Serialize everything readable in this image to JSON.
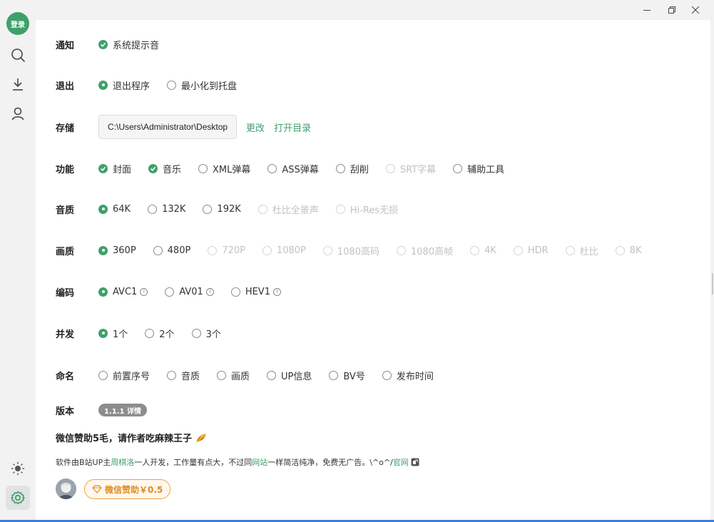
{
  "window": {
    "controls": [
      "minimize-icon",
      "restore-icon",
      "close-icon"
    ]
  },
  "sidebar": {
    "login_label": "登录",
    "icons": [
      "search-icon",
      "download-icon",
      "user-icon",
      "sun-icon",
      "gear-icon"
    ]
  },
  "settings": {
    "notify": {
      "label": "通知",
      "options": [
        {
          "label": "系统提示音",
          "checked": true
        }
      ]
    },
    "exit": {
      "label": "退出",
      "options": [
        {
          "label": "退出程序",
          "checked": true
        },
        {
          "label": "最小化到托盘",
          "checked": false
        }
      ]
    },
    "storage": {
      "label": "存储",
      "path": "C:\\Users\\Administrator\\Desktop",
      "change_label": "更改",
      "open_label": "打开目录"
    },
    "features": {
      "label": "功能",
      "options": [
        {
          "label": "封面",
          "checked": true,
          "disabled": false
        },
        {
          "label": "音乐",
          "checked": true,
          "disabled": false
        },
        {
          "label": "XML弹幕",
          "checked": false,
          "disabled": false
        },
        {
          "label": "ASS弹幕",
          "checked": false,
          "disabled": false
        },
        {
          "label": "刮削",
          "checked": false,
          "disabled": false
        },
        {
          "label": "SRT字幕",
          "checked": false,
          "disabled": true
        },
        {
          "label": "辅助工具",
          "checked": false,
          "disabled": false
        }
      ]
    },
    "audio": {
      "label": "音质",
      "options": [
        {
          "label": "64K",
          "checked": true,
          "disabled": false
        },
        {
          "label": "132K",
          "checked": false,
          "disabled": false
        },
        {
          "label": "192K",
          "checked": false,
          "disabled": false
        },
        {
          "label": "杜比全景声",
          "checked": false,
          "disabled": true
        },
        {
          "label": "Hi-Res无损",
          "checked": false,
          "disabled": true
        }
      ]
    },
    "video": {
      "label": "画质",
      "options": [
        {
          "label": "360P",
          "checked": true,
          "disabled": false
        },
        {
          "label": "480P",
          "checked": false,
          "disabled": false
        },
        {
          "label": "720P",
          "checked": false,
          "disabled": true
        },
        {
          "label": "1080P",
          "checked": false,
          "disabled": true
        },
        {
          "label": "1080高码",
          "checked": false,
          "disabled": true
        },
        {
          "label": "1080高帧",
          "checked": false,
          "disabled": true
        },
        {
          "label": "4K",
          "checked": false,
          "disabled": true
        },
        {
          "label": "HDR",
          "checked": false,
          "disabled": true
        },
        {
          "label": "杜比",
          "checked": false,
          "disabled": true
        },
        {
          "label": "8K",
          "checked": false,
          "disabled": true
        }
      ]
    },
    "codec": {
      "label": "编码",
      "info_glyph": "i",
      "options": [
        {
          "label": "AVC1",
          "checked": true
        },
        {
          "label": "AV01",
          "checked": false
        },
        {
          "label": "HEV1",
          "checked": false
        }
      ]
    },
    "concurrency": {
      "label": "并发",
      "options": [
        {
          "label": "1个",
          "checked": true
        },
        {
          "label": "2个",
          "checked": false
        },
        {
          "label": "3个",
          "checked": false
        }
      ]
    },
    "naming": {
      "label": "命名",
      "options": [
        {
          "label": "前置序号",
          "checked": false
        },
        {
          "label": "音质",
          "checked": false
        },
        {
          "label": "画质",
          "checked": false
        },
        {
          "label": "UP信息",
          "checked": false
        },
        {
          "label": "BV号",
          "checked": false
        },
        {
          "label": "发布时间",
          "checked": false
        }
      ]
    },
    "version": {
      "label": "版本",
      "badge": "1.1.1 详情"
    }
  },
  "about": {
    "sponsor_text": "微信赞助5毛，请作者吃麻辣王子",
    "desc_1": "软件由B站UP主",
    "author_link": "周棋洛",
    "desc_2": "一人开发，工作量有点大，不过同",
    "site_link": "网站",
    "desc_3": "一样简洁纯净，免费无广告。\\^o^/",
    "official_link": "官网",
    "sponsor_button": "微信赞助￥0.5"
  },
  "colors": {
    "accent": "#3fa06b",
    "disabled": "#c2c2c2",
    "sponsor": "#e08a1e"
  }
}
